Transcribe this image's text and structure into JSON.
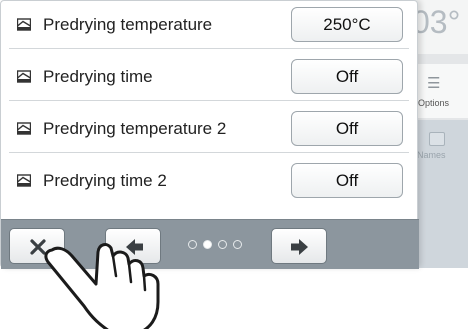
{
  "background_screen": {
    "temperature_partial": "03°",
    "options_label": "Options",
    "names_label": "Names"
  },
  "dialog": {
    "rows": [
      {
        "label": "Predrying temperature",
        "value": "250°C",
        "icon": "heating-icon"
      },
      {
        "label": "Predrying time",
        "value": "Off",
        "icon": "heating-icon"
      },
      {
        "label": "Predrying temperature 2",
        "value": "Off",
        "icon": "heating-icon"
      },
      {
        "label": "Predrying time 2",
        "value": "Off",
        "icon": "heating-icon"
      }
    ]
  },
  "toolbar": {
    "close_icon": "close-icon",
    "back_icon": "arrow-left-icon",
    "next_icon": "arrow-right-icon",
    "page_count": 4,
    "active_page": 2
  },
  "colors": {
    "toolbar": "#8c969e",
    "row_divider": "#d3d7da",
    "accent_text": "#222222"
  }
}
